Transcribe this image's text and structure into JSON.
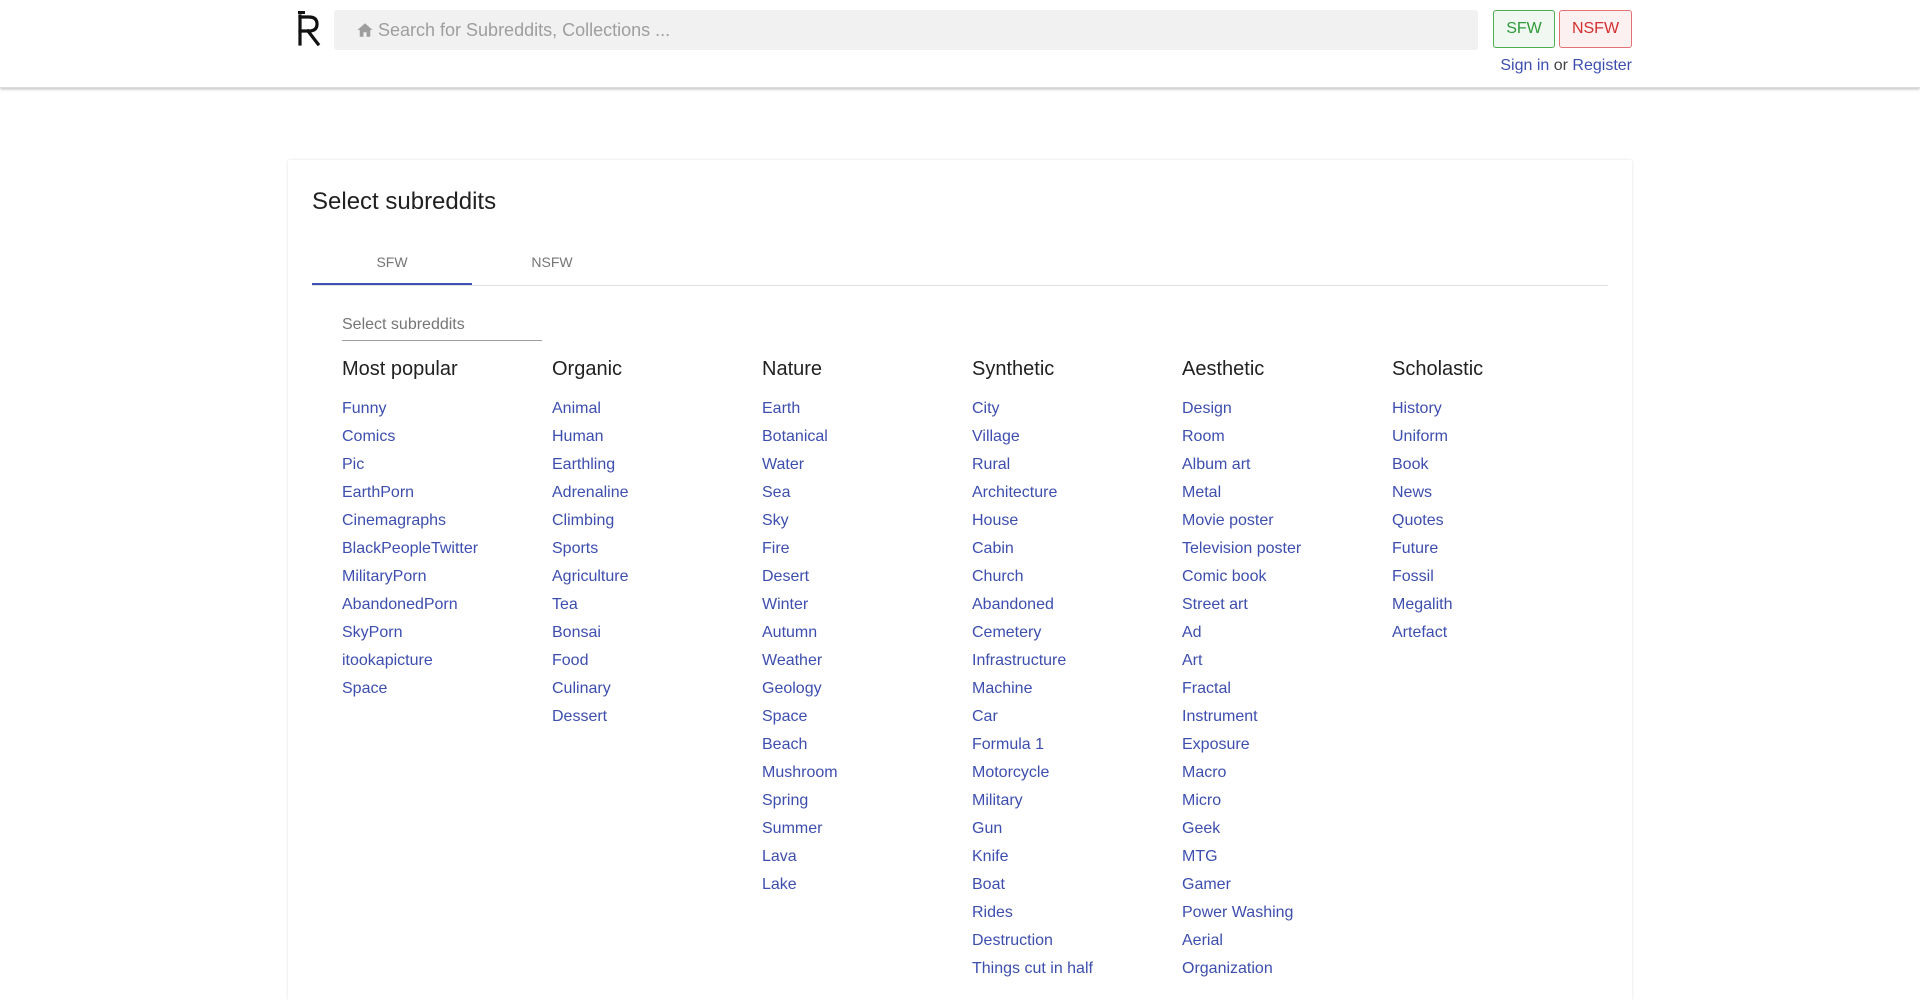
{
  "header": {
    "logo_text": "R",
    "search_placeholder": "Search for Subreddits, Collections ...",
    "sfw_button": "SFW",
    "nsfw_button": "NSFW",
    "sign_in": "Sign in",
    "or": "or",
    "register": "Register"
  },
  "main": {
    "title": "Select subreddits",
    "tabs": [
      "SFW",
      "NSFW"
    ],
    "filter_placeholder": "Select subreddits",
    "columns": [
      {
        "title": "Most popular",
        "items": [
          "Funny",
          "Comics",
          "Pic",
          "EarthPorn",
          "Cinemagraphs",
          "BlackPeopleTwitter",
          "MilitaryPorn",
          "AbandonedPorn",
          "SkyPorn",
          "itookapicture",
          "Space"
        ]
      },
      {
        "title": "Organic",
        "items": [
          "Animal",
          "Human",
          "Earthling",
          "Adrenaline",
          "Climbing",
          "Sports",
          "Agriculture",
          "Tea",
          "Bonsai",
          "Food",
          "Culinary",
          "Dessert"
        ]
      },
      {
        "title": "Nature",
        "items": [
          "Earth",
          "Botanical",
          "Water",
          "Sea",
          "Sky",
          "Fire",
          "Desert",
          "Winter",
          "Autumn",
          "Weather",
          "Geology",
          "Space",
          "Beach",
          "Mushroom",
          "Spring",
          "Summer",
          "Lava",
          "Lake"
        ]
      },
      {
        "title": "Synthetic",
        "items": [
          "City",
          "Village",
          "Rural",
          "Architecture",
          "House",
          "Cabin",
          "Church",
          "Abandoned",
          "Cemetery",
          "Infrastructure",
          "Machine",
          "Car",
          "Formula 1",
          "Motorcycle",
          "Military",
          "Gun",
          "Knife",
          "Boat",
          "Rides",
          "Destruction",
          "Things cut in half"
        ]
      },
      {
        "title": "Aesthetic",
        "items": [
          "Design",
          "Room",
          "Album art",
          "Metal",
          "Movie poster",
          "Television poster",
          "Comic book",
          "Street art",
          "Ad",
          "Art",
          "Fractal",
          "Instrument",
          "Exposure",
          "Macro",
          "Micro",
          "Geek",
          "MTG",
          "Gamer",
          "Power Washing",
          "Aerial",
          "Organization"
        ]
      },
      {
        "title": "Scholastic",
        "items": [
          "History",
          "Uniform",
          "Book",
          "News",
          "Quotes",
          "Future",
          "Fossil",
          "Megalith",
          "Artefact"
        ]
      }
    ]
  }
}
